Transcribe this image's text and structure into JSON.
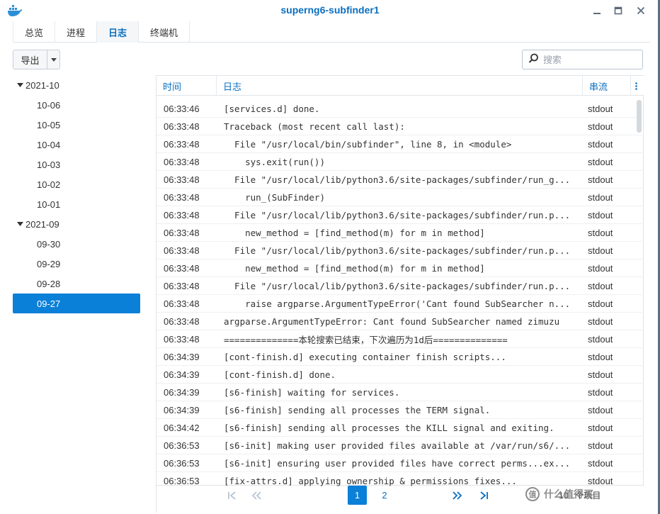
{
  "window": {
    "title": "superng6-subfinder1",
    "icon": "docker-whale-icon",
    "controls": {
      "minimize": "minimize-icon",
      "maximize": "maximize-icon",
      "close": "close-icon"
    }
  },
  "tabs": [
    {
      "label": "总览",
      "active": false
    },
    {
      "label": "进程",
      "active": false
    },
    {
      "label": "日志",
      "active": true
    },
    {
      "label": "终端机",
      "active": false
    }
  ],
  "toolbar": {
    "export_label": "导出",
    "search_placeholder": "搜索"
  },
  "tree": [
    {
      "label": "2021-10",
      "type": "month",
      "expanded": true
    },
    {
      "label": "10-06",
      "type": "day"
    },
    {
      "label": "10-05",
      "type": "day"
    },
    {
      "label": "10-04",
      "type": "day"
    },
    {
      "label": "10-03",
      "type": "day"
    },
    {
      "label": "10-02",
      "type": "day"
    },
    {
      "label": "10-01",
      "type": "day"
    },
    {
      "label": "2021-09",
      "type": "month",
      "expanded": true
    },
    {
      "label": "09-30",
      "type": "day"
    },
    {
      "label": "09-29",
      "type": "day"
    },
    {
      "label": "09-28",
      "type": "day"
    },
    {
      "label": "09-27",
      "type": "day",
      "selected": true
    }
  ],
  "grid": {
    "columns": [
      "时间",
      "日志",
      "串流"
    ],
    "rows": [
      {
        "time": "06:33:46",
        "log": "[services.d] done.",
        "stream": "stdout"
      },
      {
        "time": "06:33:48",
        "log": "Traceback (most recent call last):",
        "stream": "stdout"
      },
      {
        "time": "06:33:48",
        "log": "  File \"/usr/local/bin/subfinder\", line 8, in <module>",
        "stream": "stdout"
      },
      {
        "time": "06:33:48",
        "log": "    sys.exit(run())",
        "stream": "stdout"
      },
      {
        "time": "06:33:48",
        "log": "  File \"/usr/local/lib/python3.6/site-packages/subfinder/run_g...",
        "stream": "stdout"
      },
      {
        "time": "06:33:48",
        "log": "    run_(SubFinder)",
        "stream": "stdout"
      },
      {
        "time": "06:33:48",
        "log": "  File \"/usr/local/lib/python3.6/site-packages/subfinder/run.p...",
        "stream": "stdout"
      },
      {
        "time": "06:33:48",
        "log": "    new_method = [find_method(m) for m in method]",
        "stream": "stdout"
      },
      {
        "time": "06:33:48",
        "log": "  File \"/usr/local/lib/python3.6/site-packages/subfinder/run.p...",
        "stream": "stdout"
      },
      {
        "time": "06:33:48",
        "log": "    new_method = [find_method(m) for m in method]",
        "stream": "stdout"
      },
      {
        "time": "06:33:48",
        "log": "  File \"/usr/local/lib/python3.6/site-packages/subfinder/run.p...",
        "stream": "stdout"
      },
      {
        "time": "06:33:48",
        "log": "    raise argparse.ArgumentTypeError('Cant found SubSearcher n...",
        "stream": "stdout"
      },
      {
        "time": "06:33:48",
        "log": "argparse.ArgumentTypeError: Cant found SubSearcher named zimuzu",
        "stream": "stdout"
      },
      {
        "time": "06:33:48",
        "log": "==============本轮搜索已结束，下次遍历为1d后==============",
        "stream": "stdout"
      },
      {
        "time": "06:34:39",
        "log": "[cont-finish.d] executing container finish scripts...",
        "stream": "stdout"
      },
      {
        "time": "06:34:39",
        "log": "[cont-finish.d] done.",
        "stream": "stdout"
      },
      {
        "time": "06:34:39",
        "log": "[s6-finish] waiting for services.",
        "stream": "stdout"
      },
      {
        "time": "06:34:39",
        "log": "[s6-finish] sending all processes the TERM signal.",
        "stream": "stdout"
      },
      {
        "time": "06:34:42",
        "log": "[s6-finish] sending all processes the KILL signal and exiting.",
        "stream": "stdout"
      },
      {
        "time": "06:36:53",
        "log": "[s6-init] making user provided files available at /var/run/s6/...",
        "stream": "stdout"
      },
      {
        "time": "06:36:53",
        "log": "[s6-init] ensuring user provided files have correct perms...ex...",
        "stream": "stdout"
      },
      {
        "time": "06:36:53",
        "log": "[fix-attrs.d] applying ownership & permissions fixes...",
        "stream": "stdout"
      }
    ]
  },
  "pager": {
    "pages": [
      "1",
      "2"
    ],
    "current": "1",
    "info": "10...个项目"
  },
  "watermark": {
    "badge": "值",
    "text": "什么值得买"
  },
  "colors": {
    "accent": "#0a80d8",
    "title": "#0a6fbf",
    "border": "#dfe4e9"
  }
}
